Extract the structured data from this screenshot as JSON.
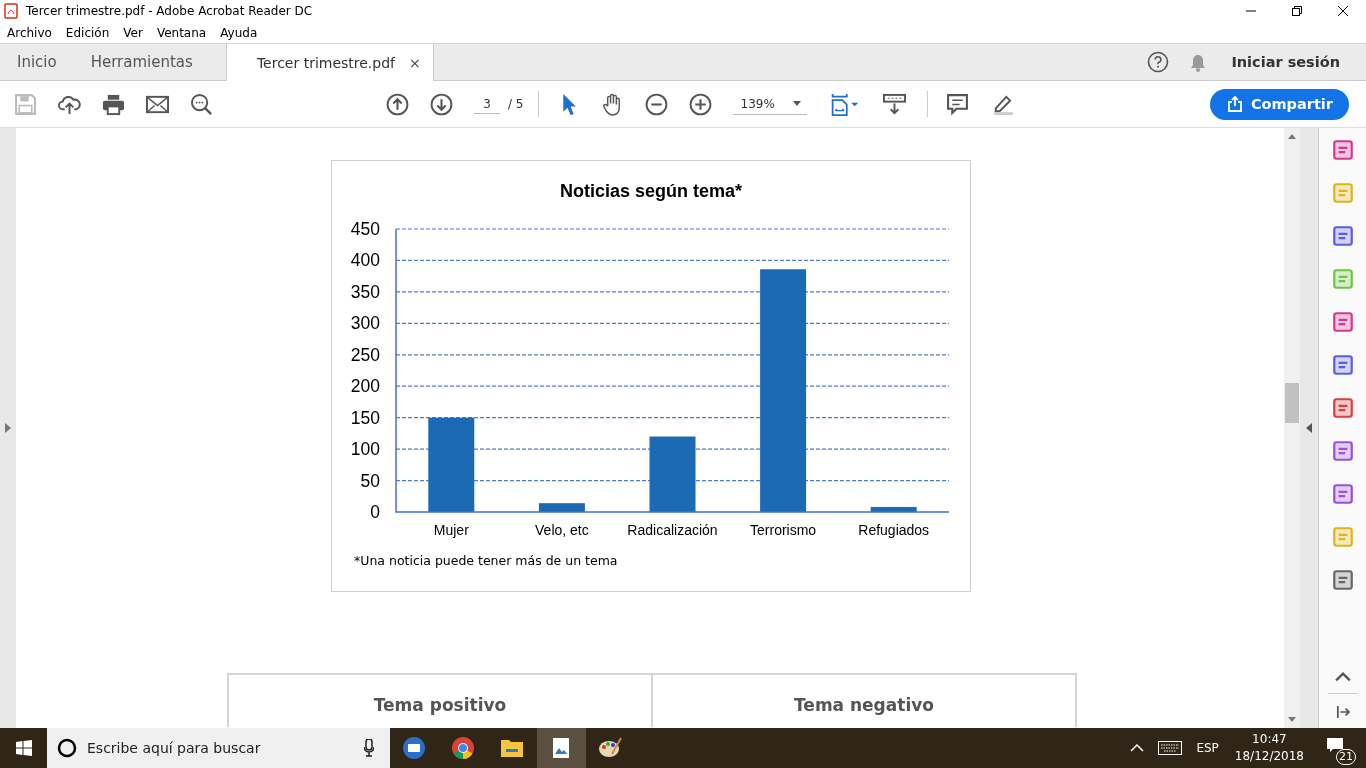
{
  "window": {
    "title": "Tercer trimestre.pdf - Adobe Acrobat Reader DC"
  },
  "menu": [
    "Archivo",
    "Edición",
    "Ver",
    "Ventana",
    "Ayuda"
  ],
  "tabs": [
    {
      "label": "Inicio",
      "selected": false
    },
    {
      "label": "Herramientas",
      "selected": false
    },
    {
      "label": "Tercer trimestre.pdf",
      "selected": true,
      "close": "×"
    }
  ],
  "account": {
    "sign_in": "Iniciar sesión"
  },
  "toolbar": {
    "page": "3",
    "page_total": "/ 5",
    "zoom": "139%",
    "share": "Compartir"
  },
  "document": {
    "chart_data": {
      "type": "bar",
      "title": "Noticias según tema*",
      "categories": [
        "Mujer",
        "Velo, etc",
        "Radicalización",
        "Terrorismo",
        "Refugiados"
      ],
      "values": [
        150,
        14,
        120,
        386,
        8
      ],
      "ylim": [
        0,
        450
      ],
      "grid": true,
      "yticks": [
        0,
        50,
        100,
        150,
        200,
        250,
        300,
        350,
        400,
        450
      ]
    },
    "footnote": "*Una noticia puede tener más de un tema",
    "table_headers": [
      "Tema positivo",
      "Tema negativo"
    ]
  },
  "taskbar": {
    "search_placeholder": "Escribe aquí para buscar",
    "language": "ESP",
    "time": "10:47",
    "date": "18/12/2018",
    "notification_count": "21"
  }
}
